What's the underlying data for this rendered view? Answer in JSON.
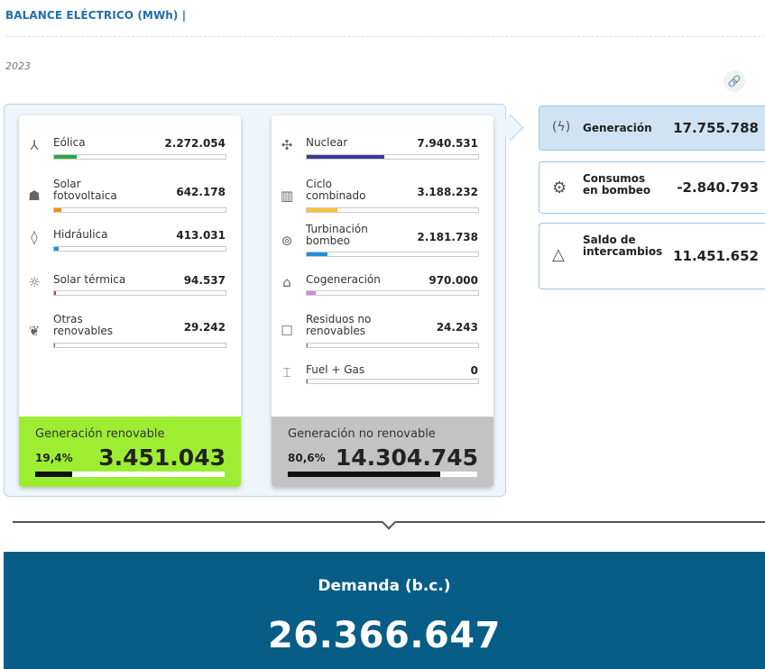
{
  "header": {
    "title": "BALANCE ELÉCTRICO (MWh) |",
    "year": "2023"
  },
  "link_button": {
    "icon": "link-icon",
    "glyph": "🔗"
  },
  "renewable": {
    "items": [
      {
        "label": "Eólica",
        "value": "2.272.054",
        "icon": "wind-turbine-icon",
        "glyph": "⅄",
        "color": "#29a744",
        "share": 0.13
      },
      {
        "label": "Solar fotovoltaica",
        "value": "642.178",
        "icon": "solar-panel-icon",
        "glyph": "☗",
        "color": "#f28c18",
        "share": 0.04
      },
      {
        "label": "Hidráulica",
        "value": "413.031",
        "icon": "water-drop-icon",
        "glyph": "◊",
        "color": "#1c8fe0",
        "share": 0.025
      },
      {
        "label": "Solar térmica",
        "value": "94.537",
        "icon": "sun-icon",
        "glyph": "☼",
        "color": "#e02b2b",
        "share": 0.01
      },
      {
        "label": "Otras renovables",
        "value": "29.242",
        "icon": "leaf-hand-icon",
        "glyph": "❦",
        "color": "#8a55c0",
        "share": 0.005
      }
    ],
    "summary": {
      "title": "Generación renovable",
      "percent": "19,4%",
      "total": "3.451.043",
      "share": 0.194
    }
  },
  "nonrenewable": {
    "items": [
      {
        "label": "Nuclear",
        "value": "7.940.531",
        "icon": "nuclear-icon",
        "glyph": "✣",
        "color": "#3b3a99",
        "share": 0.45
      },
      {
        "label": "Ciclo combinado",
        "value": "3.188.232",
        "icon": "combined-cycle-icon",
        "glyph": "▥",
        "color": "#f7c23a",
        "share": 0.18
      },
      {
        "label": "Turbinación bombeo",
        "value": "2.181.738",
        "icon": "pump-turbine-icon",
        "glyph": "⊚",
        "color": "#1c8fe0",
        "share": 0.12
      },
      {
        "label": "Cogeneración",
        "value": "970.000",
        "icon": "cogeneration-icon",
        "glyph": "⌂",
        "color": "#d08bd8",
        "share": 0.055
      },
      {
        "label": "Residuos no renovables",
        "value": "24.243",
        "icon": "waste-bin-icon",
        "glyph": "☐",
        "color": "#777777",
        "share": 0.005
      },
      {
        "label": "Fuel + Gas",
        "value": "0",
        "icon": "fuel-gas-icon",
        "glyph": "⌶",
        "color": "#e02b2b",
        "share": 0.003
      }
    ],
    "summary": {
      "title": "Generación no renovable",
      "percent": "80,6%",
      "total": "14.304.745",
      "share": 0.806
    }
  },
  "side": [
    {
      "label": "Generación",
      "value": "17.755.788",
      "icon": "generation-bolt-icon",
      "glyph": "(ϟ)"
    },
    {
      "label": "Consumos en bombeo",
      "value": "-2.840.793",
      "icon": "pump-consumption-icon",
      "glyph": "⚙"
    },
    {
      "label": "Saldo de intercambios",
      "value": "11.451.652",
      "icon": "exchange-triangle-icon",
      "glyph": "△"
    }
  ],
  "demand": {
    "label": "Demanda (b.c.)",
    "value": "26.366.647"
  }
}
